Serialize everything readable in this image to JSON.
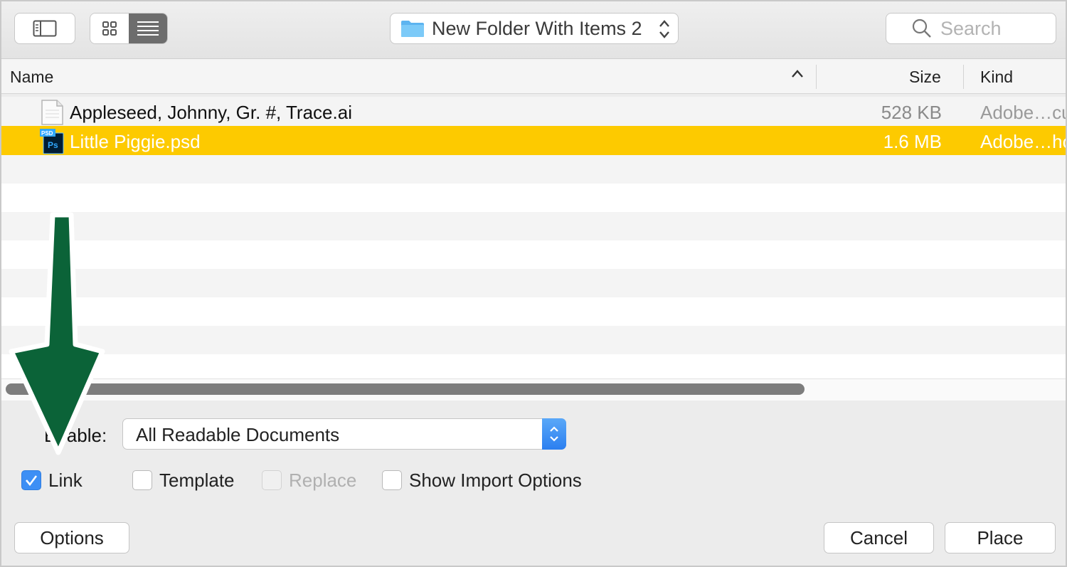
{
  "toolbar": {
    "folder_name": "New Folder With Items 2",
    "search_placeholder": "Search"
  },
  "columns": {
    "name": "Name",
    "size": "Size",
    "kind": "Kind"
  },
  "files": [
    {
      "name": "Appleseed, Johnny, Gr. #, Trace.ai",
      "size": "528 KB",
      "kind": "Adobe…cu",
      "icon": "document-icon"
    },
    {
      "name": "Little Piggie.psd",
      "size": "1.6 MB",
      "kind": "Adobe…ho",
      "icon": "photoshop-file-icon",
      "selected": true
    }
  ],
  "accessory": {
    "enable_label": "Enable:",
    "enable_value": "All Readable Documents",
    "checkboxes": {
      "link": {
        "label": "Link",
        "checked": true
      },
      "template": {
        "label": "Template",
        "checked": false
      },
      "replace": {
        "label": "Replace",
        "checked": false,
        "disabled": true
      },
      "show_import": {
        "label": "Show Import Options",
        "checked": false
      }
    }
  },
  "buttons": {
    "options": "Options",
    "cancel": "Cancel",
    "place": "Place"
  },
  "colors": {
    "selection": "#fdca00",
    "arrow": "#0b6338",
    "checkbox_accent": "#3d8ff5"
  }
}
